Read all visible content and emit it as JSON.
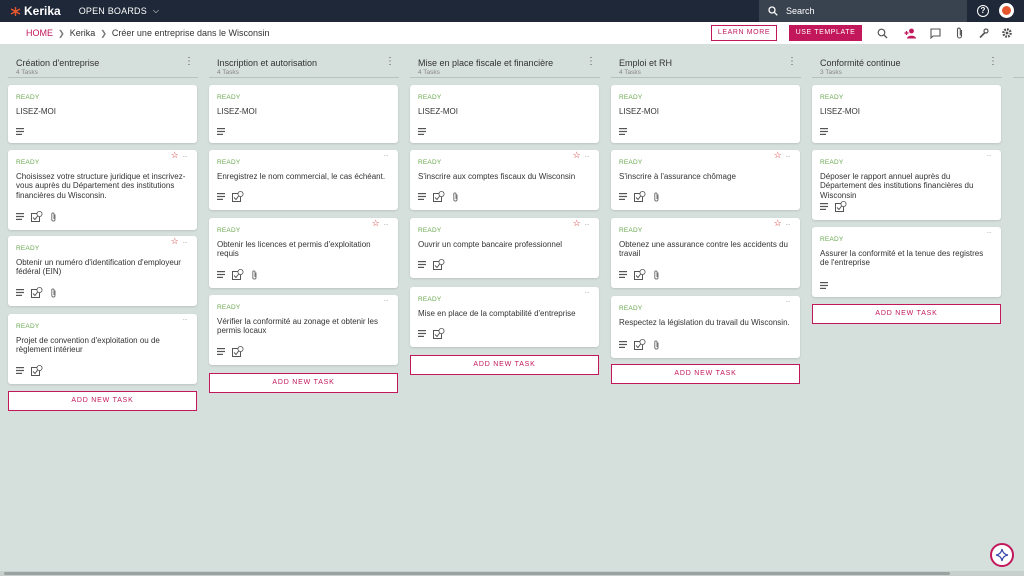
{
  "app": {
    "logo_text": "Kerika",
    "open_boards": "OPEN BOARDS"
  },
  "search": {
    "placeholder": "Search"
  },
  "breadcrumb": {
    "home": "HOME",
    "org": "Kerika",
    "board": "Créer une entreprise dans le Wisconsin"
  },
  "toolbar": {
    "learn_more": "LEARN MORE",
    "use_template": "USE TEMPLATE"
  },
  "colors": {
    "accent": "#c2185b",
    "topbar": "#1e2838",
    "ready": "#6aa84f",
    "board_bg": "#d5dfdc"
  },
  "add_task_label": "ADD NEW TASK",
  "columns": [
    {
      "title": "Création d'entreprise",
      "count": "4 Tasks",
      "cards": [
        {
          "status": "READY",
          "title": "LISEZ-MOI"
        },
        {
          "status": "READY",
          "title": "Choisissez votre structure juridique et inscrivez-vous auprès du Département des institutions financières du Wisconsin."
        },
        {
          "status": "READY",
          "title": "Obtenir un numéro d'identification d'employeur fédéral (EIN)"
        },
        {
          "status": "READY",
          "title": "Projet de convention d'exploitation ou de règlement intérieur"
        }
      ]
    },
    {
      "title": "Inscription et autorisation",
      "count": "4 Tasks",
      "cards": [
        {
          "status": "READY",
          "title": "LISEZ-MOI"
        },
        {
          "status": "READY",
          "title": "Enregistrez le nom commercial, le cas échéant."
        },
        {
          "status": "READY",
          "title": "Obtenir les licences et permis d'exploitation requis"
        },
        {
          "status": "READY",
          "title": "Vérifier la conformité au zonage et obtenir les permis locaux"
        }
      ]
    },
    {
      "title": "Mise en place fiscale et financière",
      "count": "4 Tasks",
      "cards": [
        {
          "status": "READY",
          "title": "LISEZ-MOI"
        },
        {
          "status": "READY",
          "title": "S'inscrire aux comptes fiscaux du Wisconsin"
        },
        {
          "status": "READY",
          "title": "Ouvrir un compte bancaire professionnel"
        },
        {
          "status": "READY",
          "title": "Mise en place de la comptabilité d'entreprise"
        }
      ]
    },
    {
      "title": "Emploi et RH",
      "count": "4 Tasks",
      "cards": [
        {
          "status": "READY",
          "title": "LISEZ-MOI"
        },
        {
          "status": "READY",
          "title": "S'inscrire à l'assurance chômage"
        },
        {
          "status": "READY",
          "title": "Obtenez une assurance contre les accidents du travail"
        },
        {
          "status": "READY",
          "title": "Respectez la législation du travail du Wisconsin."
        }
      ]
    },
    {
      "title": "Conformité continue",
      "count": "3 Tasks",
      "cards": [
        {
          "status": "READY",
          "title": "LISEZ-MOI"
        },
        {
          "status": "READY",
          "title": "Déposer le rapport annuel auprès du Département des institutions financières du Wisconsin"
        },
        {
          "status": "READY",
          "title": "Assurer la conformité et la tenue des registres de l'entreprise"
        }
      ]
    }
  ]
}
